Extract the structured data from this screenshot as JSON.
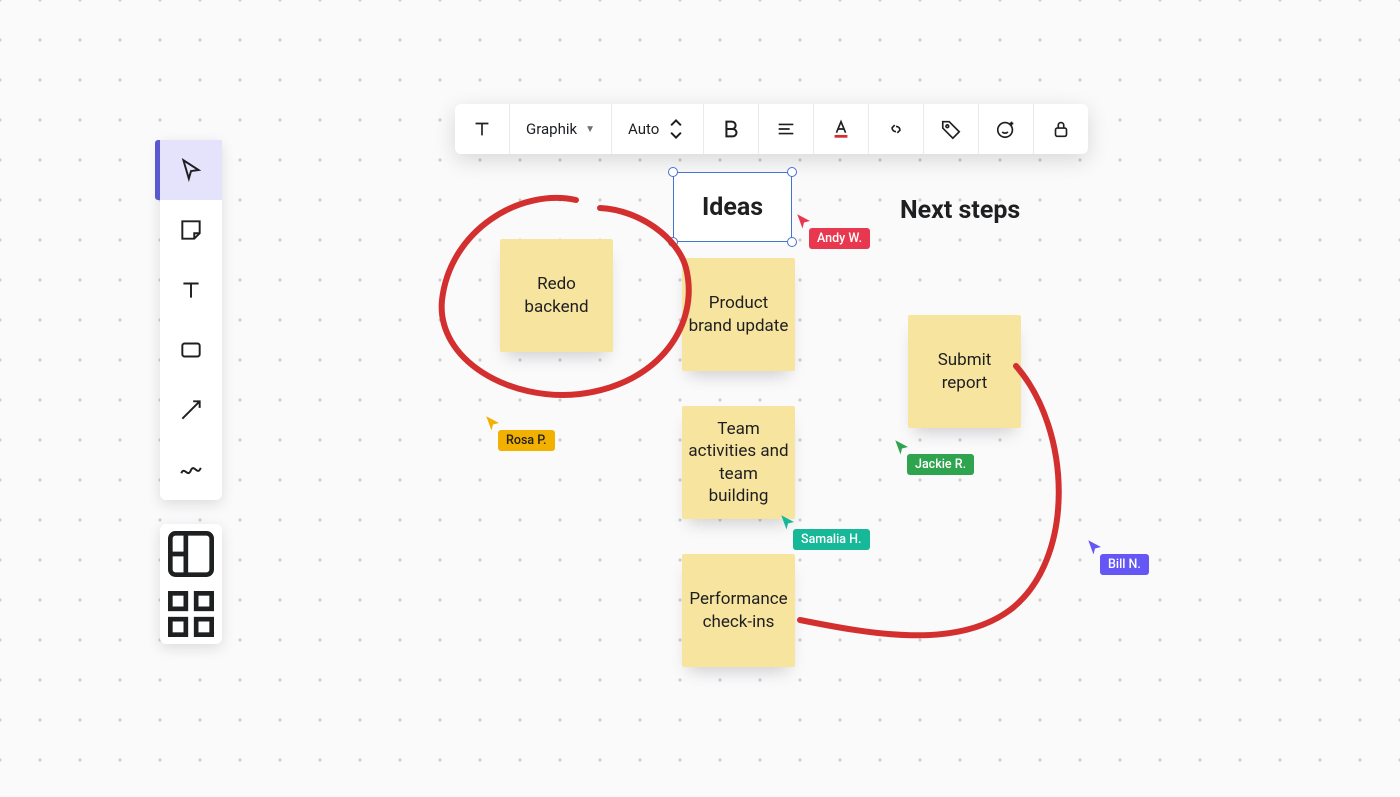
{
  "tools": {
    "select": "select",
    "sticky": "sticky-note",
    "text": "text",
    "shape": "shape",
    "connector": "connector",
    "draw": "draw",
    "section": "section",
    "widgets": "widgets"
  },
  "format_toolbar": {
    "font_family": "Graphik",
    "font_size": "Auto"
  },
  "headings": {
    "ideas": "Ideas",
    "next_steps": "Next steps"
  },
  "notes": {
    "redo_backend": "Redo backend",
    "product_brand": "Product brand update",
    "team_activities": "Team activities and team building",
    "performance": "Performance check-ins",
    "submit_report": "Submit report"
  },
  "cursors": {
    "andy": {
      "name": "Andy W.",
      "color": "#E8384F"
    },
    "rosa": {
      "name": "Rosa P.",
      "color": "#F2B000"
    },
    "samalia": {
      "name": "Samalia H.",
      "color": "#17B897"
    },
    "jackie": {
      "name": "Jackie R.",
      "color": "#2EA44F"
    },
    "bill": {
      "name": "Bill N.",
      "color": "#6557F5"
    }
  },
  "colors": {
    "ink": "#D32F2F",
    "note": "#F7E59F",
    "selection": "#4573D1",
    "tool_selected_bg": "#E5E3FB",
    "tool_accent": "#5B57D1"
  }
}
